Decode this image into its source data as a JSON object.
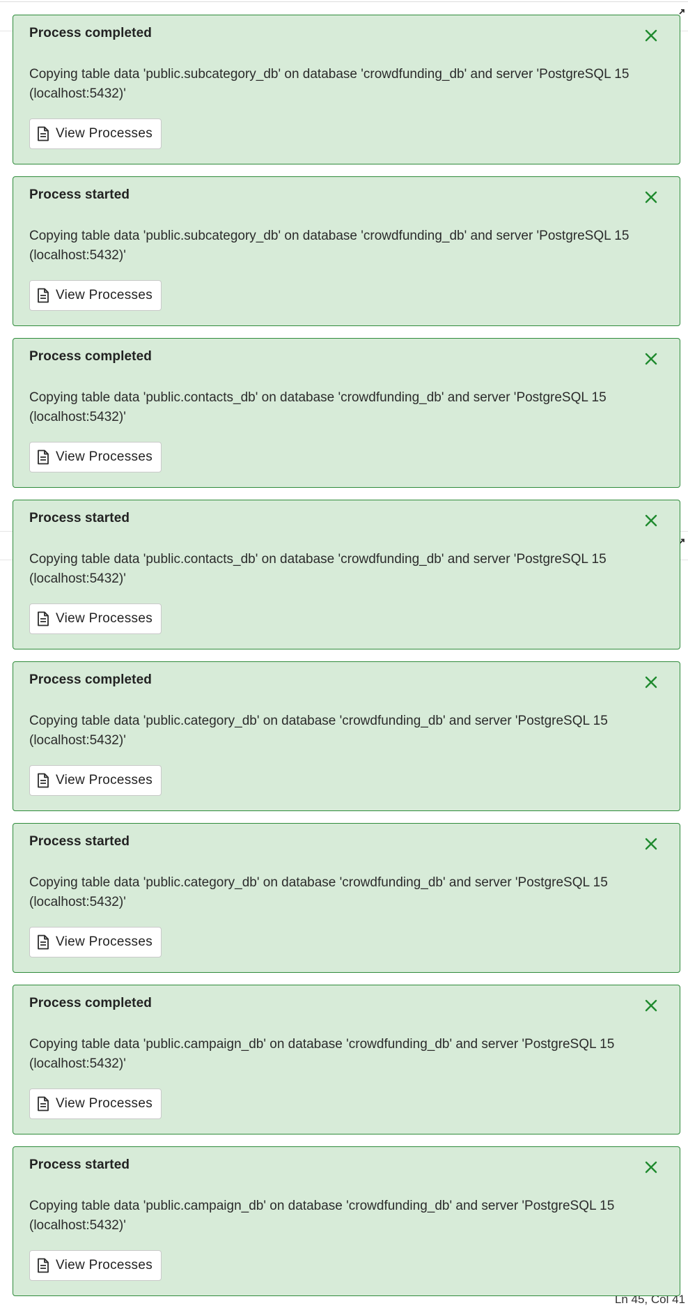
{
  "background": {
    "status_text": "Ln 45, Col 41"
  },
  "colors": {
    "toast_background": "#d7ebd8",
    "toast_border": "#2e8b3a",
    "close_icon": "#1f8a2e"
  },
  "notifications": [
    {
      "title": "Process completed",
      "message": "Copying table data 'public.subcategory_db' on database 'crowdfunding_db' and server 'PostgreSQL 15 (localhost:5432)'",
      "button_label": "View Processes"
    },
    {
      "title": "Process started",
      "message": "Copying table data 'public.subcategory_db' on database 'crowdfunding_db' and server 'PostgreSQL 15 (localhost:5432)'",
      "button_label": "View Processes"
    },
    {
      "title": "Process completed",
      "message": "Copying table data 'public.contacts_db' on database 'crowdfunding_db' and server 'PostgreSQL 15 (localhost:5432)'",
      "button_label": "View Processes"
    },
    {
      "title": "Process started",
      "message": "Copying table data 'public.contacts_db' on database 'crowdfunding_db' and server 'PostgreSQL 15 (localhost:5432)'",
      "button_label": "View Processes"
    },
    {
      "title": "Process completed",
      "message": "Copying table data 'public.category_db' on database 'crowdfunding_db' and server 'PostgreSQL 15 (localhost:5432)'",
      "button_label": "View Processes"
    },
    {
      "title": "Process started",
      "message": "Copying table data 'public.category_db' on database 'crowdfunding_db' and server 'PostgreSQL 15 (localhost:5432)'",
      "button_label": "View Processes"
    },
    {
      "title": "Process completed",
      "message": "Copying table data 'public.campaign_db' on database 'crowdfunding_db' and server 'PostgreSQL 15 (localhost:5432)'",
      "button_label": "View Processes"
    },
    {
      "title": "Process started",
      "message": "Copying table data 'public.campaign_db' on database 'crowdfunding_db' and server 'PostgreSQL 15 (localhost:5432)'",
      "button_label": "View Processes"
    }
  ]
}
